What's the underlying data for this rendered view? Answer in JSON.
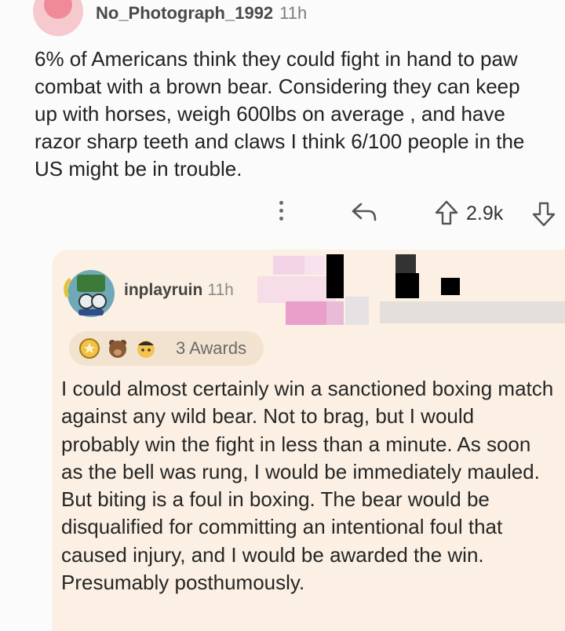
{
  "op": {
    "username": "No_Photograph_1992",
    "time": "11h",
    "body": "6% of Americans think they could fight in hand to paw combat with a brown bear. Considering they can keep up with horses, weigh 600lbs on average , and have razor sharp teeth and claws I think 6/100 people in the US might be in trouble.",
    "score": "2.9k"
  },
  "reply": {
    "username": "inplayruin",
    "time": "11h",
    "awards_label": "3 Awards",
    "body": "I could almost certainly win a sanctioned boxing match against any wild bear. Not to brag, but I would probably win the fight in less than a minute. As soon as the bell was rung, I would be immediately mauled. But biting is a foul in boxing. The bear would be disqualified for committing an intentional foul that caused injury, and I would be awarded the win. Presumably posthumously."
  },
  "icons": {
    "more": "more-options-icon",
    "reply": "reply-icon",
    "upvote": "upvote-icon",
    "downvote": "downvote-icon",
    "awards": [
      "gold-medal-award-icon",
      "bear-award-icon",
      "face-award-icon"
    ]
  },
  "colors": {
    "reply_background": "#fbf0e3",
    "awards_pill": "#f2e3d0",
    "page_background": "#fbfbfb"
  }
}
